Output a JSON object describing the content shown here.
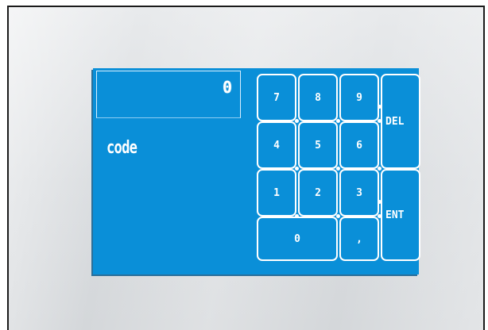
{
  "display": {
    "value": "0"
  },
  "label": {
    "text": "code"
  },
  "keypad": {
    "keys": {
      "seven": "7",
      "eight": "8",
      "nine": "9",
      "four": "4",
      "five": "5",
      "six": "6",
      "one": "1",
      "two": "2",
      "three": "3",
      "zero": "0",
      "comma": ",",
      "delete": "DEL",
      "enter": "ENT"
    }
  },
  "colors": {
    "screen_background": "#0a8fd8",
    "key_border": "#ffffff",
    "text": "#ffffff",
    "bezel": "#dcdfe2"
  }
}
